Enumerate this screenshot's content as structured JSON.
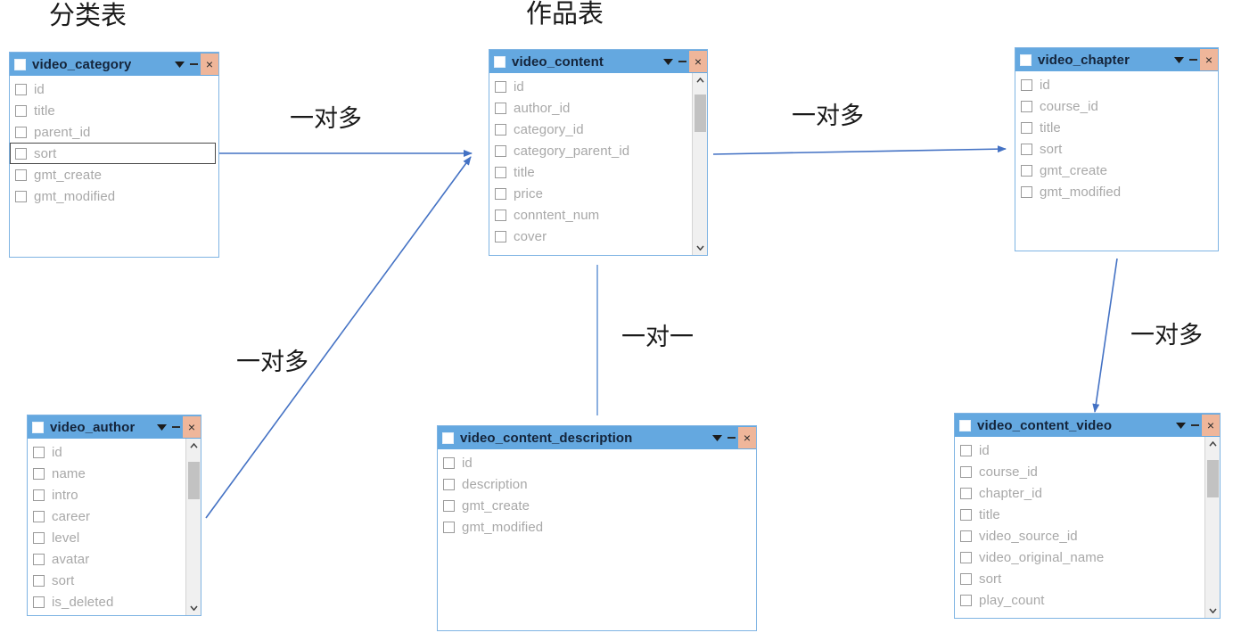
{
  "diagram": {
    "title_color": "#1a1a1a",
    "connector_color": "#4472C4",
    "titlebar_color": "#64a8e0",
    "close_button_color": "#efb69a",
    "field_text_color": "#a8a8a8"
  },
  "captions": [
    {
      "name": "category-table-caption",
      "text": "分类表"
    },
    {
      "name": "content-table-caption",
      "text": "作品表"
    }
  ],
  "relation_labels": [
    {
      "name": "category-to-content",
      "text": "一对多"
    },
    {
      "name": "content-to-chapter",
      "text": "一对多"
    },
    {
      "name": "author-to-content",
      "text": "一对多"
    },
    {
      "name": "content-to-description",
      "text": "一对一"
    },
    {
      "name": "chapter-to-content-video",
      "text": "一对多"
    }
  ],
  "window_controls": {
    "caret_icon": "chevron-down-icon",
    "minimize_icon": "minimize-icon",
    "close_label": "×"
  },
  "tables": [
    {
      "name": "video_category",
      "title": "video_category",
      "has_scrollbar": false,
      "fields": [
        {
          "label": "id",
          "selected": false
        },
        {
          "label": "title",
          "selected": false
        },
        {
          "label": "parent_id",
          "selected": false
        },
        {
          "label": "sort",
          "selected": true
        },
        {
          "label": "gmt_create",
          "selected": false
        },
        {
          "label": "gmt_modified",
          "selected": false
        }
      ]
    },
    {
      "name": "video_content",
      "title": "video_content",
      "has_scrollbar": true,
      "fields": [
        {
          "label": "id",
          "selected": false
        },
        {
          "label": "author_id",
          "selected": false
        },
        {
          "label": "category_id",
          "selected": false
        },
        {
          "label": "category_parent_id",
          "selected": false
        },
        {
          "label": "title",
          "selected": false
        },
        {
          "label": "price",
          "selected": false
        },
        {
          "label": "conntent_num",
          "selected": false
        },
        {
          "label": "cover",
          "selected": false
        }
      ]
    },
    {
      "name": "video_chapter",
      "title": "video_chapter",
      "has_scrollbar": false,
      "fields": [
        {
          "label": "id",
          "selected": false
        },
        {
          "label": "course_id",
          "selected": false
        },
        {
          "label": "title",
          "selected": false
        },
        {
          "label": "sort",
          "selected": false
        },
        {
          "label": "gmt_create",
          "selected": false
        },
        {
          "label": "gmt_modified",
          "selected": false
        }
      ]
    },
    {
      "name": "video_author",
      "title": "video_author",
      "has_scrollbar": true,
      "fields": [
        {
          "label": "id",
          "selected": false
        },
        {
          "label": "name",
          "selected": false
        },
        {
          "label": "intro",
          "selected": false
        },
        {
          "label": "career",
          "selected": false
        },
        {
          "label": "level",
          "selected": false
        },
        {
          "label": "avatar",
          "selected": false
        },
        {
          "label": "sort",
          "selected": false
        },
        {
          "label": "is_deleted",
          "selected": false
        }
      ]
    },
    {
      "name": "video_content_description",
      "title": "video_content_description",
      "has_scrollbar": false,
      "fields": [
        {
          "label": "id",
          "selected": false
        },
        {
          "label": "description",
          "selected": false
        },
        {
          "label": "gmt_create",
          "selected": false
        },
        {
          "label": "gmt_modified",
          "selected": false
        }
      ]
    },
    {
      "name": "video_content_video",
      "title": "video_content_video",
      "has_scrollbar": true,
      "fields": [
        {
          "label": "id",
          "selected": false
        },
        {
          "label": "course_id",
          "selected": false
        },
        {
          "label": "chapter_id",
          "selected": false
        },
        {
          "label": "title",
          "selected": false
        },
        {
          "label": "video_source_id",
          "selected": false
        },
        {
          "label": "video_original_name",
          "selected": false
        },
        {
          "label": "sort",
          "selected": false
        },
        {
          "label": "play_count",
          "selected": false
        }
      ]
    }
  ]
}
